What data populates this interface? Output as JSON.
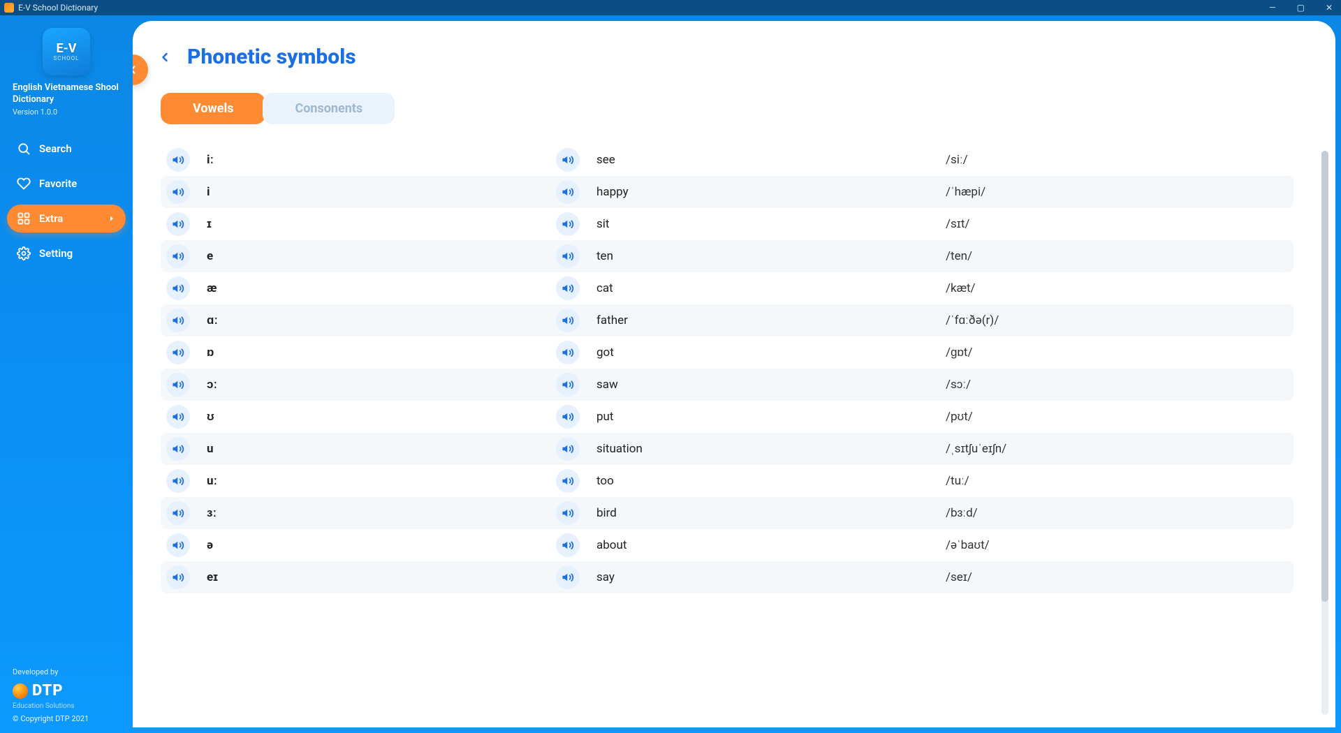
{
  "titlebar": {
    "app_title": "E-V School Dictionary"
  },
  "brand": {
    "logo_badge": "E-V",
    "logo_sub": "SCHOOL",
    "name": "English Vietnamese Shool Dictionary",
    "version": "Version 1.0.0"
  },
  "sidebar": {
    "items": [
      {
        "id": "search",
        "label": "Search",
        "icon": "search-icon",
        "active": false
      },
      {
        "id": "favorite",
        "label": "Favorite",
        "icon": "heart-icon",
        "active": false
      },
      {
        "id": "extra",
        "label": "Extra",
        "icon": "grid-icon",
        "active": true
      },
      {
        "id": "setting",
        "label": "Setting",
        "icon": "gear-icon",
        "active": false
      }
    ],
    "footer": {
      "developed_by": "Developed by",
      "brand": "DTP",
      "tagline": "Education Solutions",
      "copyright": "© Copyright DTP 2021"
    }
  },
  "page": {
    "title": "Phonetic symbols",
    "tabs": [
      {
        "id": "vowels",
        "label": "Vowels",
        "active": true
      },
      {
        "id": "consonents",
        "label": "Consonents",
        "active": false
      }
    ],
    "rows": [
      {
        "symbol": "iː",
        "word": "see",
        "pron": "/siː/"
      },
      {
        "symbol": "i",
        "word": "happy",
        "pron": "/ˈhæpi/"
      },
      {
        "symbol": "ɪ",
        "word": "sit",
        "pron": "/sɪt/"
      },
      {
        "symbol": "e",
        "word": "ten",
        "pron": "/ten/"
      },
      {
        "symbol": "æ",
        "word": "cat",
        "pron": "/kæt/"
      },
      {
        "symbol": "ɑː",
        "word": "father",
        "pron": "/ˈfɑːðə(r)/"
      },
      {
        "symbol": "ɒ",
        "word": "got",
        "pron": "/ɡɒt/"
      },
      {
        "symbol": "ɔː",
        "word": "saw",
        "pron": "/sɔː/"
      },
      {
        "symbol": "ʊ",
        "word": "put",
        "pron": "/pʊt/"
      },
      {
        "symbol": "u",
        "word": "situation",
        "pron": "/ˌsɪtʃuˈeɪʃn/"
      },
      {
        "symbol": "uː",
        "word": "too",
        "pron": "/tuː/"
      },
      {
        "symbol": "ɜː",
        "word": "bird",
        "pron": "/bɜːd/"
      },
      {
        "symbol": "ə",
        "word": "about",
        "pron": "/əˈbaʊt/"
      },
      {
        "symbol": "eɪ",
        "word": "say",
        "pron": "/seɪ/"
      }
    ]
  }
}
